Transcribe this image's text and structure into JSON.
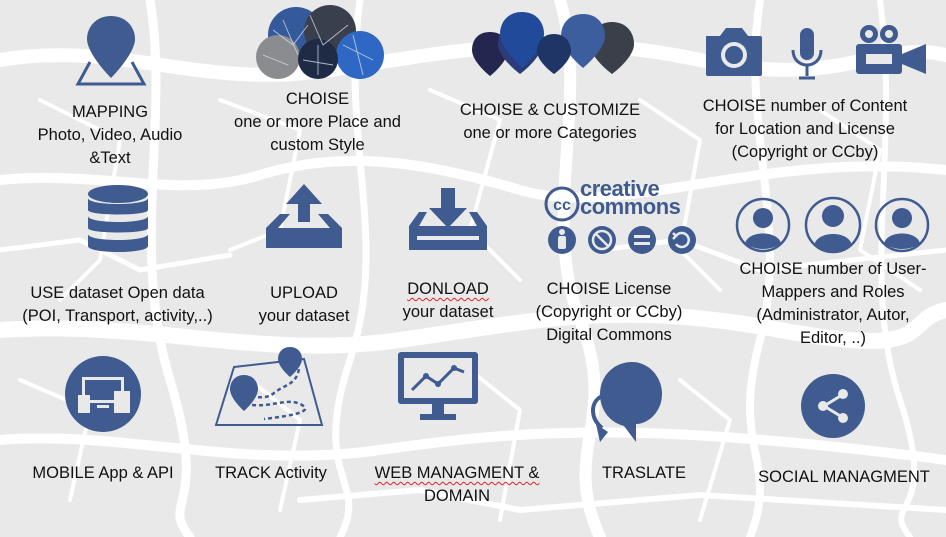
{
  "colors": {
    "primary": "#3f5b8f",
    "dark": "#2b2e57",
    "background": "#e9e9ea"
  },
  "features": [
    {
      "id": "mapping",
      "icon": "map-pin-icon",
      "lines": [
        "MAPPING",
        "Photo, Video, Audio",
        "&Text"
      ]
    },
    {
      "id": "place-style",
      "icon": "map-styles-icon",
      "lines": [
        "CHOISE",
        "one or more Place and",
        "custom Style"
      ]
    },
    {
      "id": "categories",
      "icon": "category-pins-icon",
      "lines": [
        "CHOISE & CUSTOMIZE",
        "one or more Categories"
      ]
    },
    {
      "id": "content",
      "icon": "camera-mic-video-icon",
      "lines": [
        "CHOISE number of Content",
        "for Location and License",
        "(Copyright or CCby)"
      ]
    },
    {
      "id": "dataset",
      "icon": "database-icon",
      "lines": [
        "USE dataset Open data",
        "(POI, Transport, activity,..)"
      ]
    },
    {
      "id": "upload",
      "icon": "upload-icon",
      "lines": [
        "UPLOAD",
        "your dataset"
      ]
    },
    {
      "id": "download",
      "icon": "download-icon",
      "lines": [
        "DONLOAD",
        "your dataset"
      ]
    },
    {
      "id": "license",
      "icon": "creative-commons-icon",
      "logo_text": [
        "creative",
        "commons"
      ],
      "lines": [
        "CHOISE License",
        "(Copyright or CCby)",
        "Digital Commons"
      ]
    },
    {
      "id": "users",
      "icon": "users-icon",
      "lines": [
        "CHOISE number of User-",
        "Mappers and Roles",
        "(Administrator, Autor,",
        "Editor, ..)"
      ]
    },
    {
      "id": "mobile",
      "icon": "devices-icon",
      "lines": [
        "MOBILE App & API"
      ]
    },
    {
      "id": "track",
      "icon": "track-route-icon",
      "lines": [
        "TRACK Activity"
      ]
    },
    {
      "id": "web",
      "icon": "monitor-chart-icon",
      "lines": [
        "WEB MANAGMENT &",
        "DOMAIN"
      ]
    },
    {
      "id": "translate",
      "icon": "translate-icon",
      "lines": [
        "TRASLATE"
      ]
    },
    {
      "id": "social",
      "icon": "share-icon",
      "lines": [
        "SOCIAL MANAGMENT"
      ]
    }
  ]
}
